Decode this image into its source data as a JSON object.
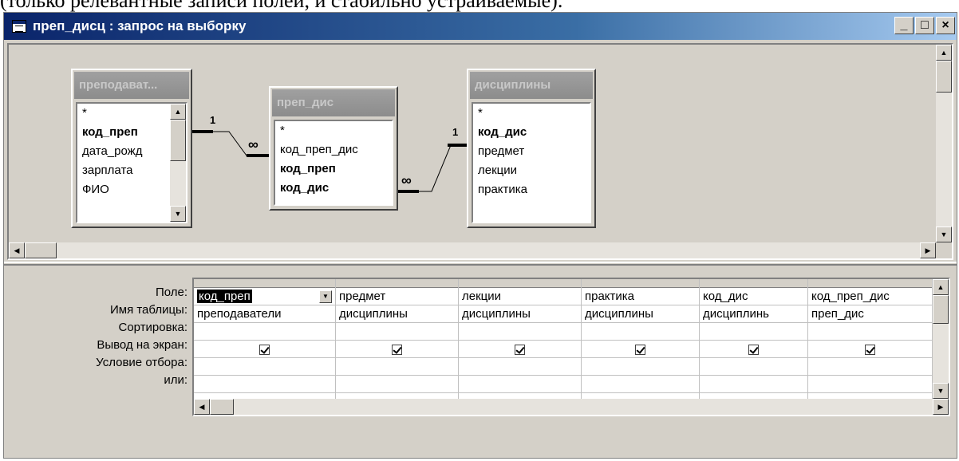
{
  "caption": "(только релевантные записи полей, и стабильно устраиваемые).",
  "window": {
    "title": "преп_дисц : запрос на выборку",
    "buttons": {
      "minimize": "_",
      "maximize": "□",
      "close": "×"
    }
  },
  "tables": [
    {
      "title": "преподават...",
      "fields": [
        {
          "name": "*",
          "bold": false
        },
        {
          "name": "код_преп",
          "bold": true
        },
        {
          "name": "дата_рожд",
          "bold": false
        },
        {
          "name": "зарплата",
          "bold": false
        },
        {
          "name": "ФИО",
          "bold": false
        }
      ]
    },
    {
      "title": "преп_дис",
      "fields": [
        {
          "name": "*",
          "bold": false
        },
        {
          "name": "код_преп_дис",
          "bold": false
        },
        {
          "name": "код_преп",
          "bold": true
        },
        {
          "name": "код_дис",
          "bold": true
        }
      ]
    },
    {
      "title": "дисциплины",
      "fields": [
        {
          "name": "*",
          "bold": false
        },
        {
          "name": "код_дис",
          "bold": true
        },
        {
          "name": "предмет",
          "bold": false
        },
        {
          "name": "лекции",
          "bold": false
        },
        {
          "name": "практика",
          "bold": false
        }
      ]
    }
  ],
  "relations": [
    {
      "one": "1",
      "many": "∞"
    },
    {
      "one": "1",
      "many": "∞"
    }
  ],
  "grid": {
    "row_labels": [
      "Поле:",
      "Имя таблицы:",
      "Сортировка:",
      "Вывод на экран:",
      "Условие отбора:",
      "или:"
    ],
    "columns": [
      {
        "field": "код_преп",
        "table": "преподаватели",
        "sort": "",
        "show": true
      },
      {
        "field": "предмет",
        "table": "дисциплины",
        "sort": "",
        "show": true
      },
      {
        "field": "лекции",
        "table": "дисциплины",
        "sort": "",
        "show": true
      },
      {
        "field": "практика",
        "table": "дисциплины",
        "sort": "",
        "show": true
      },
      {
        "field": "код_дис",
        "table": "дисциплинь",
        "sort": "",
        "show": true
      },
      {
        "field": "код_преп_дис",
        "table": "преп_дис",
        "sort": "",
        "show": true
      }
    ]
  }
}
